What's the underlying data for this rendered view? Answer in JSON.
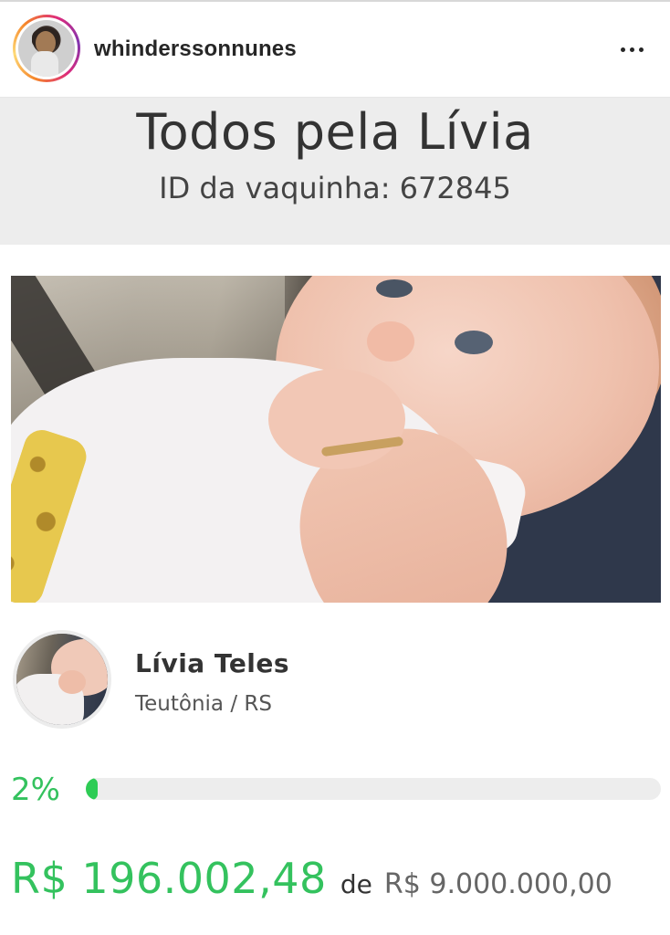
{
  "post_header": {
    "username": "whinderssonnunes",
    "avatar_icon": "profile-photo",
    "more_icon": "more-horizontal-icon",
    "ring_colors": [
      "#f58529",
      "#dd2a7b",
      "#8134af"
    ]
  },
  "campaign": {
    "title": "Todos pela Lívia",
    "id_text": "ID da vaquinha: 672845"
  },
  "beneficiary": {
    "name": "Lívia Teles",
    "location": "Teutônia / RS"
  },
  "progress": {
    "percent_label": "2%",
    "percent_value": 2,
    "color": "#2ecc55"
  },
  "amounts": {
    "raised": "R$ 196.002,48",
    "connector": "de",
    "goal": "R$ 9.000.000,00"
  }
}
